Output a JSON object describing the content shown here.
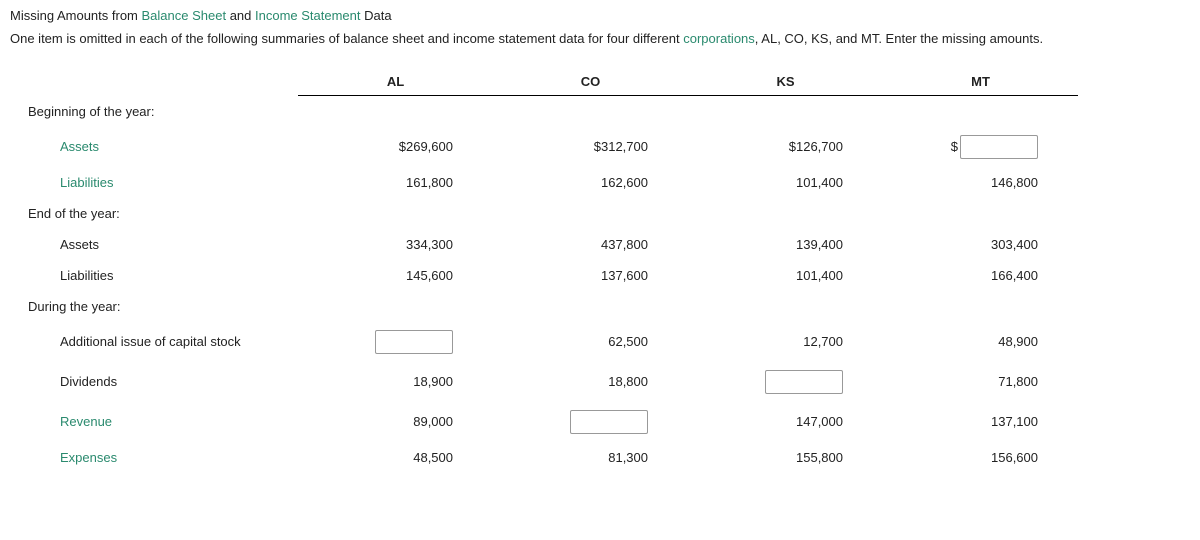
{
  "title_prefix": "Missing Amounts from ",
  "title_link1": "Balance Sheet",
  "title_mid": " and ",
  "title_link2": "Income Statement",
  "title_suffix": " Data",
  "intro_prefix": "One item is omitted in each of the following summaries of balance sheet and income statement data for four different ",
  "intro_link": "corporations",
  "intro_suffix": ", AL, CO, KS, and MT. Enter the missing amounts.",
  "headers": {
    "al": "AL",
    "co": "CO",
    "ks": "KS",
    "mt": "MT"
  },
  "sections": {
    "begin": "Beginning of the year:",
    "end": "End of the year:",
    "during": "During the year:"
  },
  "row_labels": {
    "assets": "Assets",
    "liabilities": "Liabilities",
    "assets2": "Assets",
    "liabilities2": "Liabilities",
    "add_stock": "Additional issue of capital stock",
    "dividends": "Dividends",
    "revenue": "Revenue",
    "expenses": "Expenses"
  },
  "values": {
    "begin_assets": {
      "al": "$269,600",
      "co": "$312,700",
      "ks": "$126,700",
      "mt_prefix": "$"
    },
    "begin_liab": {
      "al": "161,800",
      "co": "162,600",
      "ks": "101,400",
      "mt": "146,800"
    },
    "end_assets": {
      "al": "334,300",
      "co": "437,800",
      "ks": "139,400",
      "mt": "303,400"
    },
    "end_liab": {
      "al": "145,600",
      "co": "137,600",
      "ks": "101,400",
      "mt": "166,400"
    },
    "add_stock": {
      "co": "62,500",
      "ks": "12,700",
      "mt": "48,900"
    },
    "dividends": {
      "al": "18,900",
      "co": "18,800",
      "mt": "71,800"
    },
    "revenue": {
      "al": "89,000",
      "ks": "147,000",
      "mt": "137,100"
    },
    "expenses": {
      "al": "48,500",
      "co": "81,300",
      "ks": "155,800",
      "mt": "156,600"
    }
  }
}
